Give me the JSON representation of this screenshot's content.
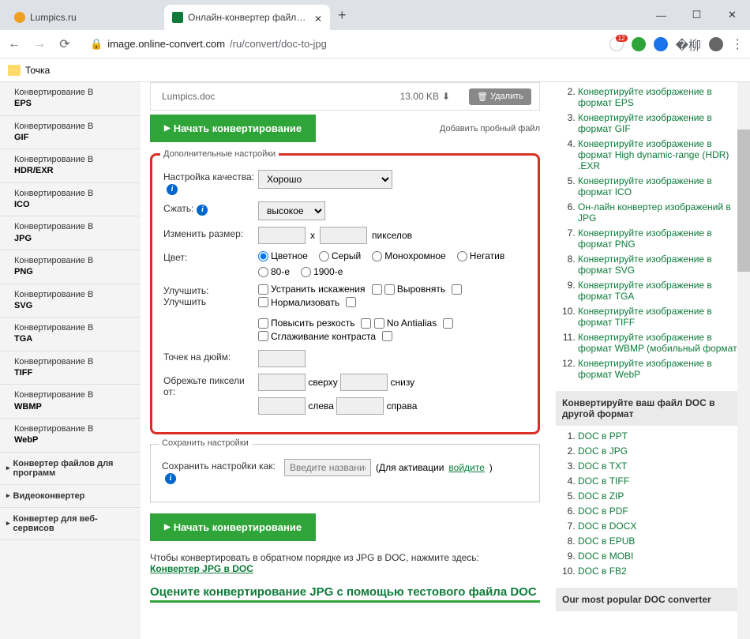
{
  "tabs": [
    {
      "title": "Lumpics.ru"
    },
    {
      "title": "Онлайн-конвертер файлов DOC"
    }
  ],
  "url": {
    "lock": "image.online-convert.com",
    "path": "/ru/convert/doc-to-jpg"
  },
  "bookmark": "Точка",
  "sidebar": {
    "prefix": "Конвертирование В",
    "formats": [
      "EPS",
      "GIF",
      "HDR/EXR",
      "ICO",
      "JPG",
      "PNG",
      "SVG",
      "TGA",
      "TIFF",
      "WBMP",
      "WebP"
    ],
    "cats": [
      "Конвертер файлов для программ",
      "Видеоконвертер",
      "Конвертер для веб-сервисов"
    ]
  },
  "file": {
    "name": "Lumpics.doc",
    "size": "13.00 KB",
    "delete": "Удалить"
  },
  "startbtn": "Начать конвертирование",
  "addfile": "Добавить пробный файл",
  "settings": {
    "legend": "Дополнительные настройки",
    "quality_label": "Настройка качества:",
    "quality_val": "Хорошо",
    "compress_label": "Сжать:",
    "compress_val": "высокое",
    "resize_label": "Изменить размер:",
    "resize_sep": "x",
    "resize_unit": "пикселов",
    "color_label": "Цвет:",
    "colors": [
      "Цветное",
      "Серый",
      "Монохромное",
      "Негатив",
      "80-е",
      "1900-е"
    ],
    "improve_label": "Улучшить:",
    "improve_sub": "Улучшить",
    "improves1": [
      "Устранить искажения",
      "Выровнять",
      "Нормализовать"
    ],
    "improves2": [
      "Повысить резкость",
      "No Antialias",
      "Сглаживание контраста"
    ],
    "dpi_label": "Точек на дюйм:",
    "crop_label": "Обрежьте пиксели от:",
    "crop1": "сверху",
    "crop2": "снизу",
    "crop3": "слева",
    "crop4": "справа"
  },
  "save": {
    "legend": "Сохранить настройки",
    "label": "Сохранить настройки как:",
    "placeholder": "Введите название",
    "hint1": "(Для активации ",
    "hint2": "войдите",
    "hint3": ")"
  },
  "back": {
    "text": "Чтобы конвертировать в обратном порядке из JPG в DOC, нажмите здесь:",
    "link": "Конвертер JPG в DOC"
  },
  "rate": "Оцените конвертирование JPG с помощью тестового файла DOC",
  "right": {
    "start": 2,
    "items": [
      "Конвертируйте изображение в формат EPS",
      "Конвертируйте изображение в формат GIF",
      "Конвертируйте изображение в формат High dynamic-range (HDR) .EXR",
      "Конвертируйте изображение в формат ICO",
      "Он-лайн конвертер изображений в JPG",
      "Конвертируйте изображение в формат PNG",
      "Конвертируйте изображение в формат SVG",
      "Конвертируйте изображение в формат TGA",
      "Конвертируйте изображение в формат TIFF",
      "Конвертируйте изображение в формат WBMP (мобильный формат)",
      "Конвертируйте изображение в формат WebP"
    ],
    "box1": "Конвертируйте ваш файл DOC в другой формат",
    "fmts": [
      "DOC в PPT",
      "DOC в JPG",
      "DOC в TXT",
      "DOC в TIFF",
      "DOC в ZIP",
      "DOC в PDF",
      "DOC в DOCX",
      "DOC в EPUB",
      "DOC в MOBI",
      "DOC в FB2"
    ],
    "box2": "Our most popular DOC converter"
  }
}
